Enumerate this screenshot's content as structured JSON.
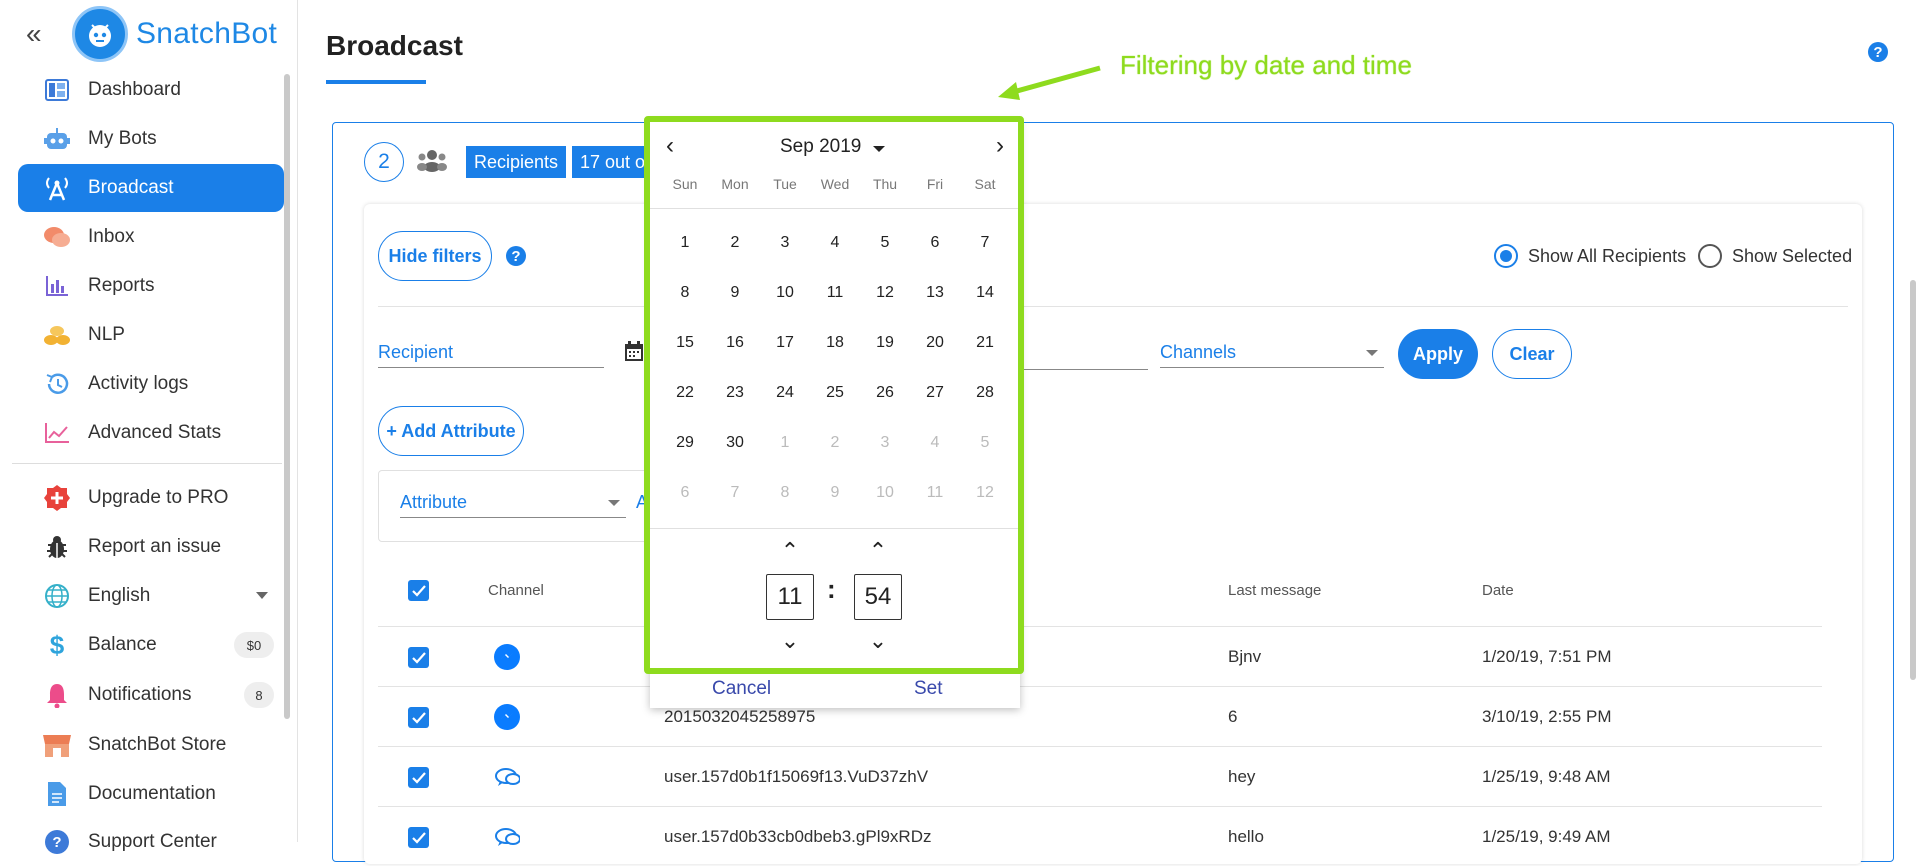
{
  "brand": {
    "name": "SnatchBot"
  },
  "sidebar": {
    "items": [
      {
        "label": "Dashboard",
        "icon": "dashboard-icon"
      },
      {
        "label": "My Bots",
        "icon": "robot-icon"
      },
      {
        "label": "Broadcast",
        "icon": "broadcast-icon",
        "active": true
      },
      {
        "label": "Inbox",
        "icon": "chat-icon"
      },
      {
        "label": "Reports",
        "icon": "bar-chart-icon"
      },
      {
        "label": "NLP",
        "icon": "nlp-icon"
      },
      {
        "label": "Activity logs",
        "icon": "history-icon"
      },
      {
        "label": "Advanced Stats",
        "icon": "trend-icon"
      },
      {
        "label": "Upgrade to PRO",
        "icon": "plus-badge-icon"
      },
      {
        "label": "Report an issue",
        "icon": "bug-icon"
      },
      {
        "label": "English",
        "icon": "globe-icon"
      },
      {
        "label": "Balance",
        "icon": "dollar-icon",
        "badge": "$0"
      },
      {
        "label": "Notifications",
        "icon": "bell-icon",
        "badge": "8"
      },
      {
        "label": "SnatchBot Store",
        "icon": "store-icon"
      },
      {
        "label": "Documentation",
        "icon": "document-icon"
      },
      {
        "label": "Support Center",
        "icon": "help-icon"
      }
    ]
  },
  "page": {
    "title": "Broadcast"
  },
  "annotation": {
    "text": "Filtering by date and time"
  },
  "step": {
    "number": "2",
    "recipients_tag": "Recipients",
    "count_tag": "17 out o"
  },
  "filters": {
    "hide_filters": "Hide filters",
    "show_all": "Show All Recipients",
    "show_selected": "Show Selected",
    "recipient_label": "Recipient",
    "channels_label": "Channels",
    "apply": "Apply",
    "clear": "Clear",
    "add_attribute": "+ Add Attribute",
    "attribute_label": "Attribute",
    "attribute_value_partial": "A"
  },
  "table": {
    "headers": {
      "channel": "Channel",
      "last_message": "Last message",
      "date": "Date"
    },
    "rows": [
      {
        "channel": "messenger",
        "id": "",
        "last_message": "Bjnv",
        "date": "1/20/19, 7:51 PM"
      },
      {
        "channel": "messenger",
        "id": "2015032045258975",
        "last_message": "6",
        "date": "3/10/19, 2:55 PM"
      },
      {
        "channel": "webchat",
        "id": "user.157d0b1f15069f13.VuD37zhV",
        "last_message": "hey",
        "date": "1/25/19, 9:48 AM"
      },
      {
        "channel": "webchat",
        "id": "user.157d0b33cb0dbeb3.gPl9xRDz",
        "last_message": "hello",
        "date": "1/25/19, 9:49 AM"
      }
    ]
  },
  "datepicker": {
    "month_label": "Sep 2019",
    "weekdays": [
      "Sun",
      "Mon",
      "Tue",
      "Wed",
      "Thu",
      "Fri",
      "Sat"
    ],
    "weeks": [
      [
        "1",
        "2",
        "3",
        "4",
        "5",
        "6",
        "7"
      ],
      [
        "8",
        "9",
        "10",
        "11",
        "12",
        "13",
        "14"
      ],
      [
        "15",
        "16",
        "17",
        "18",
        "19",
        "20",
        "21"
      ],
      [
        "22",
        "23",
        "24",
        "25",
        "26",
        "27",
        "28"
      ],
      [
        "29",
        "30",
        "1",
        "2",
        "3",
        "4",
        "5"
      ],
      [
        "6",
        "7",
        "8",
        "9",
        "10",
        "11",
        "12"
      ]
    ],
    "hour": "11",
    "minute": "54",
    "cancel": "Cancel",
    "set": "Set"
  },
  "colors": {
    "accent": "#1a7fe8",
    "annotation": "#8edb1e"
  }
}
